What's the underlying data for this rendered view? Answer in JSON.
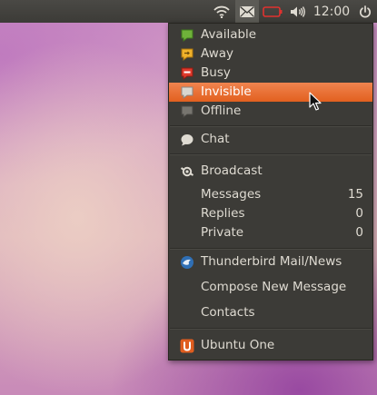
{
  "panel": {
    "clock": "12:00",
    "icons": [
      "wifi-icon",
      "mail-icon",
      "battery-icon",
      "volume-icon",
      "power-icon"
    ],
    "battery_color": "#e0322f"
  },
  "menu": {
    "status": {
      "items": [
        {
          "label": "Available",
          "icon": "available-icon",
          "color": "#6fb23a",
          "selected": true
        },
        {
          "label": "Away",
          "icon": "away-icon",
          "color": "#f0b22b",
          "selected": false
        },
        {
          "label": "Busy",
          "icon": "busy-icon",
          "color": "#e03a2c",
          "selected": false
        },
        {
          "label": "Invisible",
          "icon": "invisible-icon",
          "color": "#b0aea8",
          "selected": false,
          "highlighted": true
        },
        {
          "label": "Offline",
          "icon": "offline-icon",
          "color": "#77756f",
          "selected": false
        }
      ]
    },
    "chat": {
      "label": "Chat",
      "icon": "chat-icon"
    },
    "broadcast": {
      "label": "Broadcast",
      "icon": "broadcast-icon",
      "rows": [
        {
          "label": "Messages",
          "count": "15"
        },
        {
          "label": "Replies",
          "count": "0"
        },
        {
          "label": "Private",
          "count": "0"
        }
      ]
    },
    "thunderbird": {
      "label": "Thunderbird Mail/News",
      "icon": "thunderbird-icon",
      "items": [
        {
          "label": "Compose New Message"
        },
        {
          "label": "Contacts"
        }
      ]
    },
    "ubuntu_one": {
      "label": "Ubuntu One",
      "icon": "ubuntu-one-icon",
      "color": "#e05d1f"
    }
  },
  "accent": "#e2601f"
}
